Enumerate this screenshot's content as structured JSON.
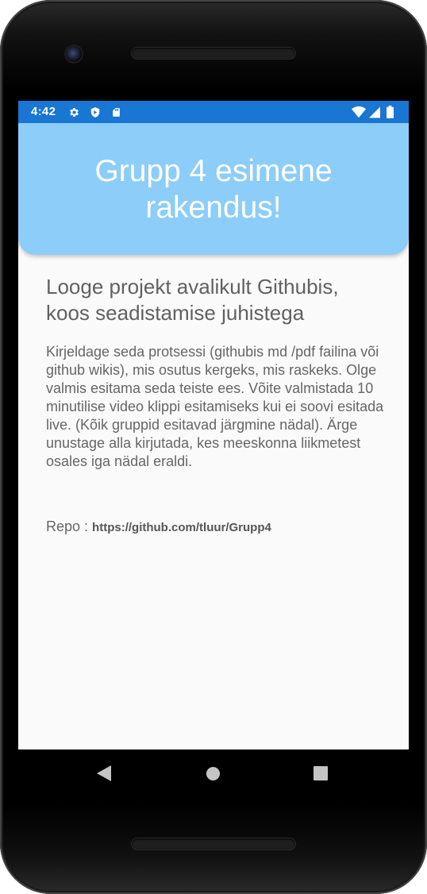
{
  "status_bar": {
    "time": "4:42",
    "left_icons": [
      "gear-icon",
      "shield-icon",
      "sd-card-icon"
    ],
    "right_icons": [
      "wifi-icon",
      "signal-icon",
      "battery-icon"
    ],
    "background_color": "#1976d2"
  },
  "app": {
    "header_title": "Grupp 4 esimene rakendus!",
    "header_color": "#8ccdf9",
    "subtitle": "Looge projekt avalikult Githubis, koos seadistamise juhistega",
    "description": " Kirjeldage seda protsessi (githubis md /pdf failina või github wikis), mis osutus kergeks, mis raskeks. Olge valmis esitama seda teiste ees. Võite valmistada 10 minutilise video klippi esitamiseks kui ei soovi esitada live. (Kõik gruppid esitavad järgmine nädal). Ärge unustage alla kirjutada, kes meeskonna liikmetest osales iga nädal eraldi.",
    "repo_label": "Repo : ",
    "repo_link": "https://github.com/tluur/Grupp4"
  },
  "nav_bar": {
    "buttons": [
      "back-icon",
      "home-icon",
      "recents-icon"
    ]
  }
}
